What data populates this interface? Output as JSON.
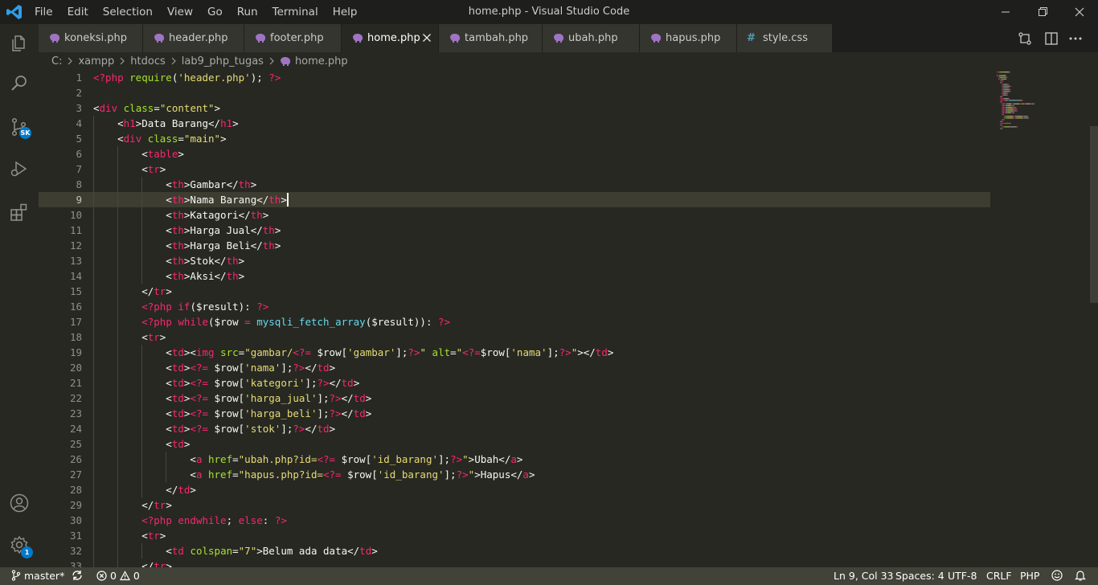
{
  "window": {
    "title": "home.php - Visual Studio Code"
  },
  "menu": [
    "File",
    "Edit",
    "Selection",
    "View",
    "Go",
    "Run",
    "Terminal",
    "Help"
  ],
  "tabs": [
    {
      "label": "koneksi.php",
      "icon": "php-elephant-icon"
    },
    {
      "label": "header.php",
      "icon": "php-elephant-icon"
    },
    {
      "label": "footer.php",
      "icon": "php-elephant-icon"
    },
    {
      "label": "home.php",
      "icon": "php-elephant-icon",
      "active": true
    },
    {
      "label": "tambah.php",
      "icon": "php-elephant-icon"
    },
    {
      "label": "ubah.php",
      "icon": "php-elephant-icon"
    },
    {
      "label": "hapus.php",
      "icon": "php-elephant-icon"
    },
    {
      "label": "style.css",
      "icon": "css-hash-icon"
    }
  ],
  "breadcrumb": [
    "C:",
    "xampp",
    "htdocs",
    "lab9_php_tugas",
    "home.php"
  ],
  "activity_badges": {
    "source_control": "SK",
    "settings": "1"
  },
  "editor": {
    "current_line": 9,
    "lines": [
      [
        [
          "t",
          "<?php "
        ],
        [
          "a",
          "require"
        ],
        [
          "w",
          "("
        ],
        [
          "s",
          "'header.php'"
        ],
        [
          "w",
          "); "
        ],
        [
          "t",
          "?>"
        ]
      ],
      [],
      [
        [
          "w",
          "<"
        ],
        [
          "t",
          "div"
        ],
        [
          "w",
          " "
        ],
        [
          "a",
          "class"
        ],
        [
          "w",
          "="
        ],
        [
          "s",
          "\"content\""
        ],
        [
          "w",
          ">"
        ]
      ],
      [
        [
          "w",
          "    <"
        ],
        [
          "t",
          "h1"
        ],
        [
          "w",
          ">Data Barang</"
        ],
        [
          "t",
          "h1"
        ],
        [
          "w",
          ">"
        ]
      ],
      [
        [
          "w",
          "    <"
        ],
        [
          "t",
          "div"
        ],
        [
          "w",
          " "
        ],
        [
          "a",
          "class"
        ],
        [
          "w",
          "="
        ],
        [
          "s",
          "\"main\""
        ],
        [
          "w",
          ">"
        ]
      ],
      [
        [
          "w",
          "        <"
        ],
        [
          "t",
          "table"
        ],
        [
          "w",
          ">"
        ]
      ],
      [
        [
          "w",
          "        <"
        ],
        [
          "t",
          "tr"
        ],
        [
          "w",
          ">"
        ]
      ],
      [
        [
          "w",
          "            <"
        ],
        [
          "t",
          "th"
        ],
        [
          "w",
          ">Gambar</"
        ],
        [
          "t",
          "th"
        ],
        [
          "w",
          ">"
        ]
      ],
      [
        [
          "w",
          "            <"
        ],
        [
          "t",
          "th"
        ],
        [
          "w",
          ">Nama Barang</"
        ],
        [
          "t",
          "th"
        ],
        [
          "w",
          ">"
        ]
      ],
      [
        [
          "w",
          "            <"
        ],
        [
          "t",
          "th"
        ],
        [
          "w",
          ">Katagori</"
        ],
        [
          "t",
          "th"
        ],
        [
          "w",
          ">"
        ]
      ],
      [
        [
          "w",
          "            <"
        ],
        [
          "t",
          "th"
        ],
        [
          "w",
          ">Harga Jual</"
        ],
        [
          "t",
          "th"
        ],
        [
          "w",
          ">"
        ]
      ],
      [
        [
          "w",
          "            <"
        ],
        [
          "t",
          "th"
        ],
        [
          "w",
          ">Harga Beli</"
        ],
        [
          "t",
          "th"
        ],
        [
          "w",
          ">"
        ]
      ],
      [
        [
          "w",
          "            <"
        ],
        [
          "t",
          "th"
        ],
        [
          "w",
          ">Stok</"
        ],
        [
          "t",
          "th"
        ],
        [
          "w",
          ">"
        ]
      ],
      [
        [
          "w",
          "            <"
        ],
        [
          "t",
          "th"
        ],
        [
          "w",
          ">Aksi</"
        ],
        [
          "t",
          "th"
        ],
        [
          "w",
          ">"
        ]
      ],
      [
        [
          "w",
          "        </"
        ],
        [
          "t",
          "tr"
        ],
        [
          "w",
          ">"
        ]
      ],
      [
        [
          "w",
          "        "
        ],
        [
          "t",
          "<?php "
        ],
        [
          "t",
          "if"
        ],
        [
          "w",
          "($result): "
        ],
        [
          "t",
          "?>"
        ]
      ],
      [
        [
          "w",
          "        "
        ],
        [
          "t",
          "<?php "
        ],
        [
          "t",
          "while"
        ],
        [
          "w",
          "($row "
        ],
        [
          "t",
          "="
        ],
        [
          "w",
          " "
        ],
        [
          "f",
          "mysqli_fetch_array"
        ],
        [
          "w",
          "($result)): "
        ],
        [
          "t",
          "?>"
        ]
      ],
      [
        [
          "w",
          "        <"
        ],
        [
          "t",
          "tr"
        ],
        [
          "w",
          ">"
        ]
      ],
      [
        [
          "w",
          "            <"
        ],
        [
          "t",
          "td"
        ],
        [
          "w",
          "><"
        ],
        [
          "t",
          "img"
        ],
        [
          "w",
          " "
        ],
        [
          "a",
          "src"
        ],
        [
          "w",
          "="
        ],
        [
          "s",
          "\"gambar/"
        ],
        [
          "t",
          "<?="
        ],
        [
          "w",
          " $row["
        ],
        [
          "s",
          "'gambar'"
        ],
        [
          "w",
          "];"
        ],
        [
          "t",
          "?>"
        ],
        [
          "s",
          "\""
        ],
        [
          "w",
          " "
        ],
        [
          "a",
          "alt"
        ],
        [
          "w",
          "="
        ],
        [
          "s",
          "\""
        ],
        [
          "t",
          "<?="
        ],
        [
          "w",
          "$row["
        ],
        [
          "s",
          "'nama'"
        ],
        [
          "w",
          "];"
        ],
        [
          "t",
          "?>"
        ],
        [
          "s",
          "\""
        ],
        [
          "w",
          "></"
        ],
        [
          "t",
          "td"
        ],
        [
          "w",
          ">"
        ]
      ],
      [
        [
          "w",
          "            <"
        ],
        [
          "t",
          "td"
        ],
        [
          "w",
          ">"
        ],
        [
          "t",
          "<?="
        ],
        [
          "w",
          " $row["
        ],
        [
          "s",
          "'nama'"
        ],
        [
          "w",
          "];"
        ],
        [
          "t",
          "?>"
        ],
        [
          "w",
          "</"
        ],
        [
          "t",
          "td"
        ],
        [
          "w",
          ">"
        ]
      ],
      [
        [
          "w",
          "            <"
        ],
        [
          "t",
          "td"
        ],
        [
          "w",
          ">"
        ],
        [
          "t",
          "<?="
        ],
        [
          "w",
          " $row["
        ],
        [
          "s",
          "'kategori'"
        ],
        [
          "w",
          "];"
        ],
        [
          "t",
          "?>"
        ],
        [
          "w",
          "</"
        ],
        [
          "t",
          "td"
        ],
        [
          "w",
          ">"
        ]
      ],
      [
        [
          "w",
          "            <"
        ],
        [
          "t",
          "td"
        ],
        [
          "w",
          ">"
        ],
        [
          "t",
          "<?="
        ],
        [
          "w",
          " $row["
        ],
        [
          "s",
          "'harga_jual'"
        ],
        [
          "w",
          "];"
        ],
        [
          "t",
          "?>"
        ],
        [
          "w",
          "</"
        ],
        [
          "t",
          "td"
        ],
        [
          "w",
          ">"
        ]
      ],
      [
        [
          "w",
          "            <"
        ],
        [
          "t",
          "td"
        ],
        [
          "w",
          ">"
        ],
        [
          "t",
          "<?="
        ],
        [
          "w",
          " $row["
        ],
        [
          "s",
          "'harga_beli'"
        ],
        [
          "w",
          "];"
        ],
        [
          "t",
          "?>"
        ],
        [
          "w",
          "</"
        ],
        [
          "t",
          "td"
        ],
        [
          "w",
          ">"
        ]
      ],
      [
        [
          "w",
          "            <"
        ],
        [
          "t",
          "td"
        ],
        [
          "w",
          ">"
        ],
        [
          "t",
          "<?="
        ],
        [
          "w",
          " $row["
        ],
        [
          "s",
          "'stok'"
        ],
        [
          "w",
          "];"
        ],
        [
          "t",
          "?>"
        ],
        [
          "w",
          "</"
        ],
        [
          "t",
          "td"
        ],
        [
          "w",
          ">"
        ]
      ],
      [
        [
          "w",
          "            <"
        ],
        [
          "t",
          "td"
        ],
        [
          "w",
          ">"
        ]
      ],
      [
        [
          "w",
          "                <"
        ],
        [
          "t",
          "a"
        ],
        [
          "w",
          " "
        ],
        [
          "a",
          "href"
        ],
        [
          "w",
          "="
        ],
        [
          "s",
          "\"ubah.php?id="
        ],
        [
          "t",
          "<?="
        ],
        [
          "w",
          " $row["
        ],
        [
          "s",
          "'id_barang'"
        ],
        [
          "w",
          "];"
        ],
        [
          "t",
          "?>"
        ],
        [
          "s",
          "\""
        ],
        [
          "w",
          ">Ubah</"
        ],
        [
          "t",
          "a"
        ],
        [
          "w",
          ">"
        ]
      ],
      [
        [
          "w",
          "                <"
        ],
        [
          "t",
          "a"
        ],
        [
          "w",
          " "
        ],
        [
          "a",
          "href"
        ],
        [
          "w",
          "="
        ],
        [
          "s",
          "\"hapus.php?id="
        ],
        [
          "t",
          "<?="
        ],
        [
          "w",
          " $row["
        ],
        [
          "s",
          "'id_barang'"
        ],
        [
          "w",
          "];"
        ],
        [
          "t",
          "?>"
        ],
        [
          "s",
          "\""
        ],
        [
          "w",
          ">Hapus</"
        ],
        [
          "t",
          "a"
        ],
        [
          "w",
          ">"
        ]
      ],
      [
        [
          "w",
          "            </"
        ],
        [
          "t",
          "td"
        ],
        [
          "w",
          ">"
        ]
      ],
      [
        [
          "w",
          "        </"
        ],
        [
          "t",
          "tr"
        ],
        [
          "w",
          ">"
        ]
      ],
      [
        [
          "w",
          "        "
        ],
        [
          "t",
          "<?php "
        ],
        [
          "t",
          "endwhile"
        ],
        [
          "w",
          "; "
        ],
        [
          "t",
          "else"
        ],
        [
          "w",
          ": "
        ],
        [
          "t",
          "?>"
        ]
      ],
      [
        [
          "w",
          "        <"
        ],
        [
          "t",
          "tr"
        ],
        [
          "w",
          ">"
        ]
      ],
      [
        [
          "w",
          "            <"
        ],
        [
          "t",
          "td"
        ],
        [
          "w",
          " "
        ],
        [
          "a",
          "colspan"
        ],
        [
          "w",
          "="
        ],
        [
          "s",
          "\"7\""
        ],
        [
          "w",
          ">Belum ada data</"
        ],
        [
          "t",
          "td"
        ],
        [
          "w",
          ">"
        ]
      ],
      [
        [
          "w",
          "        </"
        ],
        [
          "t",
          "tr"
        ],
        [
          "w",
          ">"
        ]
      ]
    ]
  },
  "status": {
    "branch": "master*",
    "errors": "0",
    "warnings": "0",
    "position": "Ln 9, Col 33",
    "spaces": "Spaces: 4",
    "encoding": "UTF-8",
    "eol": "CRLF",
    "language": "PHP"
  }
}
